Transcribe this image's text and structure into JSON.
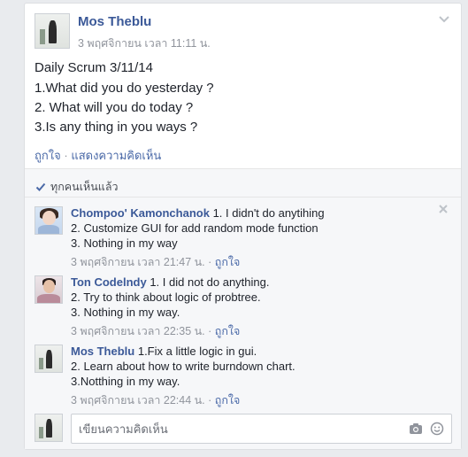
{
  "post": {
    "author": "Mos Theblu",
    "timestamp": "3 พฤศจิกายน เวลา 11:11 น.",
    "lines": [
      "Daily Scrum 3/11/14",
      "1.What did you do yesterday ?",
      "2. What will you do today ?",
      "3.Is any thing in you ways ?"
    ],
    "like_label": "ถูกใจ",
    "separator": "·",
    "comment_label": "แสดงความคิดเห็น"
  },
  "seen_label": "ทุกคนเห็นแล้ว",
  "comments": [
    {
      "author": "Chompoo' Kamonchanok",
      "lines": [
        "1. I didn't do anytihing",
        "2. Customize GUI for add random mode function",
        "3. Nothing in my way"
      ],
      "timestamp": "3 พฤศจิกายน เวลา 21:47 น.",
      "like_label": "ถูกใจ"
    },
    {
      "author": "Ton Codelndy",
      "lines": [
        "1. I did not do anything.",
        "2. Try to think about logic of probtree.",
        "3. Nothing in my way."
      ],
      "timestamp": "3 พฤศจิกายน เวลา 22:35 น.",
      "like_label": "ถูกใจ"
    },
    {
      "author": "Mos Theblu",
      "lines": [
        "1.Fix a little logic in gui.",
        "2. Learn about how to write burndown chart.",
        "3.Notthing in my way."
      ],
      "timestamp": "3 พฤศจิกายน เวลา 22:44 น.",
      "like_label": "ถูกใจ"
    }
  ],
  "comment_input": {
    "placeholder": "เขียนความคิดเห็น",
    "value": ""
  },
  "icons": {
    "chevron": "chevron-down-icon",
    "check": "check-icon",
    "close": "close-icon",
    "camera": "camera-icon",
    "emoji": "smiley-icon"
  },
  "colors": {
    "link": "#3b5998",
    "meta": "#90949c",
    "background": "#e9ebee"
  }
}
